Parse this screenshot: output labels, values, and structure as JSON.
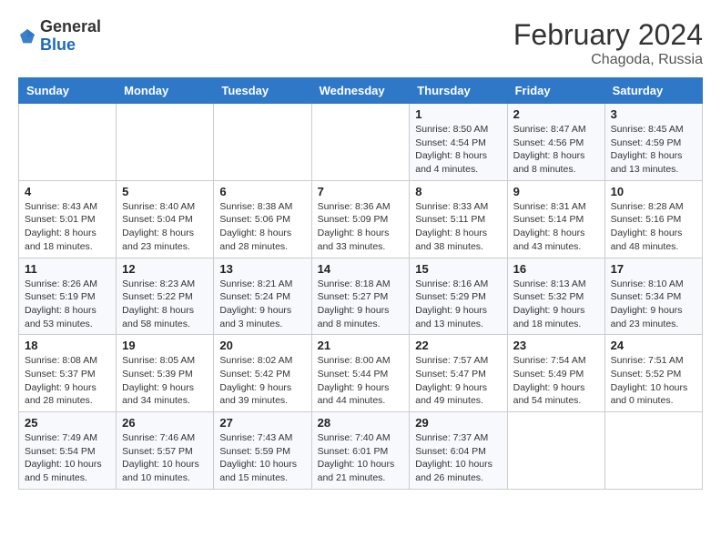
{
  "header": {
    "logo_general": "General",
    "logo_blue": "Blue",
    "month_year": "February 2024",
    "location": "Chagoda, Russia"
  },
  "columns": [
    "Sunday",
    "Monday",
    "Tuesday",
    "Wednesday",
    "Thursday",
    "Friday",
    "Saturday"
  ],
  "weeks": [
    [
      {
        "day": "",
        "detail": ""
      },
      {
        "day": "",
        "detail": ""
      },
      {
        "day": "",
        "detail": ""
      },
      {
        "day": "",
        "detail": ""
      },
      {
        "day": "1",
        "detail": "Sunrise: 8:50 AM\nSunset: 4:54 PM\nDaylight: 8 hours\nand 4 minutes."
      },
      {
        "day": "2",
        "detail": "Sunrise: 8:47 AM\nSunset: 4:56 PM\nDaylight: 8 hours\nand 8 minutes."
      },
      {
        "day": "3",
        "detail": "Sunrise: 8:45 AM\nSunset: 4:59 PM\nDaylight: 8 hours\nand 13 minutes."
      }
    ],
    [
      {
        "day": "4",
        "detail": "Sunrise: 8:43 AM\nSunset: 5:01 PM\nDaylight: 8 hours\nand 18 minutes."
      },
      {
        "day": "5",
        "detail": "Sunrise: 8:40 AM\nSunset: 5:04 PM\nDaylight: 8 hours\nand 23 minutes."
      },
      {
        "day": "6",
        "detail": "Sunrise: 8:38 AM\nSunset: 5:06 PM\nDaylight: 8 hours\nand 28 minutes."
      },
      {
        "day": "7",
        "detail": "Sunrise: 8:36 AM\nSunset: 5:09 PM\nDaylight: 8 hours\nand 33 minutes."
      },
      {
        "day": "8",
        "detail": "Sunrise: 8:33 AM\nSunset: 5:11 PM\nDaylight: 8 hours\nand 38 minutes."
      },
      {
        "day": "9",
        "detail": "Sunrise: 8:31 AM\nSunset: 5:14 PM\nDaylight: 8 hours\nand 43 minutes."
      },
      {
        "day": "10",
        "detail": "Sunrise: 8:28 AM\nSunset: 5:16 PM\nDaylight: 8 hours\nand 48 minutes."
      }
    ],
    [
      {
        "day": "11",
        "detail": "Sunrise: 8:26 AM\nSunset: 5:19 PM\nDaylight: 8 hours\nand 53 minutes."
      },
      {
        "day": "12",
        "detail": "Sunrise: 8:23 AM\nSunset: 5:22 PM\nDaylight: 8 hours\nand 58 minutes."
      },
      {
        "day": "13",
        "detail": "Sunrise: 8:21 AM\nSunset: 5:24 PM\nDaylight: 9 hours\nand 3 minutes."
      },
      {
        "day": "14",
        "detail": "Sunrise: 8:18 AM\nSunset: 5:27 PM\nDaylight: 9 hours\nand 8 minutes."
      },
      {
        "day": "15",
        "detail": "Sunrise: 8:16 AM\nSunset: 5:29 PM\nDaylight: 9 hours\nand 13 minutes."
      },
      {
        "day": "16",
        "detail": "Sunrise: 8:13 AM\nSunset: 5:32 PM\nDaylight: 9 hours\nand 18 minutes."
      },
      {
        "day": "17",
        "detail": "Sunrise: 8:10 AM\nSunset: 5:34 PM\nDaylight: 9 hours\nand 23 minutes."
      }
    ],
    [
      {
        "day": "18",
        "detail": "Sunrise: 8:08 AM\nSunset: 5:37 PM\nDaylight: 9 hours\nand 28 minutes."
      },
      {
        "day": "19",
        "detail": "Sunrise: 8:05 AM\nSunset: 5:39 PM\nDaylight: 9 hours\nand 34 minutes."
      },
      {
        "day": "20",
        "detail": "Sunrise: 8:02 AM\nSunset: 5:42 PM\nDaylight: 9 hours\nand 39 minutes."
      },
      {
        "day": "21",
        "detail": "Sunrise: 8:00 AM\nSunset: 5:44 PM\nDaylight: 9 hours\nand 44 minutes."
      },
      {
        "day": "22",
        "detail": "Sunrise: 7:57 AM\nSunset: 5:47 PM\nDaylight: 9 hours\nand 49 minutes."
      },
      {
        "day": "23",
        "detail": "Sunrise: 7:54 AM\nSunset: 5:49 PM\nDaylight: 9 hours\nand 54 minutes."
      },
      {
        "day": "24",
        "detail": "Sunrise: 7:51 AM\nSunset: 5:52 PM\nDaylight: 10 hours\nand 0 minutes."
      }
    ],
    [
      {
        "day": "25",
        "detail": "Sunrise: 7:49 AM\nSunset: 5:54 PM\nDaylight: 10 hours\nand 5 minutes."
      },
      {
        "day": "26",
        "detail": "Sunrise: 7:46 AM\nSunset: 5:57 PM\nDaylight: 10 hours\nand 10 minutes."
      },
      {
        "day": "27",
        "detail": "Sunrise: 7:43 AM\nSunset: 5:59 PM\nDaylight: 10 hours\nand 15 minutes."
      },
      {
        "day": "28",
        "detail": "Sunrise: 7:40 AM\nSunset: 6:01 PM\nDaylight: 10 hours\nand 21 minutes."
      },
      {
        "day": "29",
        "detail": "Sunrise: 7:37 AM\nSunset: 6:04 PM\nDaylight: 10 hours\nand 26 minutes."
      },
      {
        "day": "",
        "detail": ""
      },
      {
        "day": "",
        "detail": ""
      }
    ]
  ]
}
